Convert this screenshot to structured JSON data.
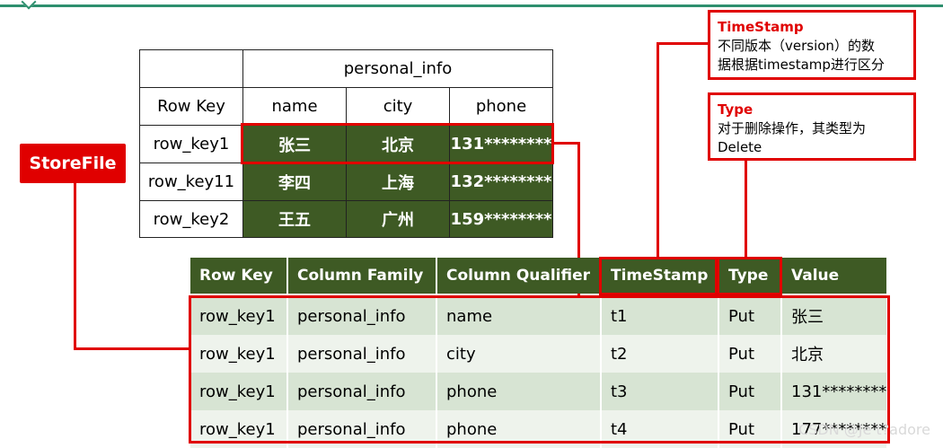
{
  "top_table": {
    "header_group": "personal_info",
    "row_key_header": "Row Key",
    "columns": [
      "name",
      "city",
      "phone"
    ],
    "rows": [
      {
        "key": "row_key1",
        "name": "张三",
        "city": "北京",
        "phone": "131********"
      },
      {
        "key": "row_key11",
        "name": "李四",
        "city": "上海",
        "phone": "132********"
      },
      {
        "key": "row_key2",
        "name": "王五",
        "city": "广州",
        "phone": "159********"
      }
    ]
  },
  "storefile_label": "StoreFile",
  "notes": {
    "timestamp": {
      "title": "TimeStamp",
      "line1": "不同版本（version）的数",
      "line2": "据根据timestamp进行区分"
    },
    "type": {
      "title": "Type",
      "line1": "对于删除操作，其类型为",
      "line2": "Delete"
    }
  },
  "bottom_table": {
    "headers": [
      "Row Key",
      "Column Family",
      "Column Qualifier",
      "TimeStamp",
      "Type",
      "Value"
    ],
    "rows": [
      [
        "row_key1",
        "personal_info",
        "name",
        "t1",
        "Put",
        "张三"
      ],
      [
        "row_key1",
        "personal_info",
        "city",
        "t2",
        "Put",
        "北京"
      ],
      [
        "row_key1",
        "personal_info",
        "phone",
        "t3",
        "Put",
        "131********"
      ],
      [
        "row_key1",
        "personal_info",
        "phone",
        "t4",
        "Put",
        "177********"
      ]
    ]
  },
  "watermark": "CSDN @Je t?adore",
  "colors": {
    "header_green": "#3e5a24",
    "highlight_red": "#e00000",
    "row_light": "#d7e4d3"
  }
}
